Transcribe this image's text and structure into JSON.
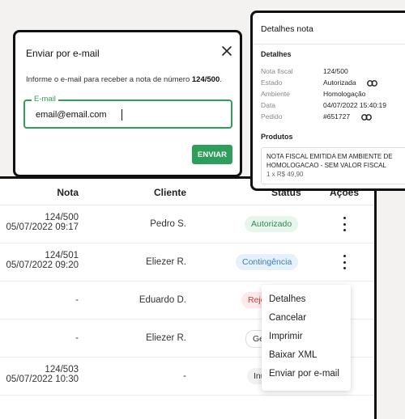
{
  "table": {
    "headers": {
      "nota": "Nota",
      "cliente": "Cliente",
      "status": "Status",
      "acoes": "Ações"
    },
    "rows": [
      {
        "nota_number": "124/500",
        "nota_date": "05/07/2022 09:17",
        "cliente": "Pedro S.",
        "status": "Autorizado"
      },
      {
        "nota_number": "124/501",
        "nota_date": "05/07/2022 09:20",
        "cliente": "Eliezer R.",
        "status": "Contingência"
      },
      {
        "nota_dash": "-",
        "cliente": "Eduardo D.",
        "status": "Rejeitado",
        "status_visible": "Reje"
      },
      {
        "nota_dash": "-",
        "cliente": "Eliezer R.",
        "status": "Gerada",
        "status_visible": "Ge"
      },
      {
        "nota_number": "124/503",
        "nota_date": "05/07/2022 10:30",
        "cliente": "-",
        "status": "Inutilizada",
        "status_visible": "Inu"
      }
    ]
  },
  "menu": {
    "items": [
      "Detalhes",
      "Cancelar",
      "Imprimir",
      "Baixar XML",
      "Enviar por e-mail"
    ]
  },
  "email_dialog": {
    "title": "Enviar por e-mail",
    "text_prefix": "Informe o e-mail para receber a nota de número ",
    "nota_number": "124/500",
    "text_suffix": ".",
    "field_label": "E-mail",
    "field_value": "email@email.com",
    "send_label": "ENVIAR"
  },
  "details": {
    "title": "Detalhes nota",
    "section_detalhes": "Detalhes",
    "fields": [
      {
        "label": "Nota fiscal",
        "value": "124/500"
      },
      {
        "label": "Estado",
        "value": "Autorizada"
      },
      {
        "label": "Ambiente",
        "value": "Homologação"
      },
      {
        "label": "Data",
        "value": "04/07/2022 15:40:19"
      },
      {
        "label": "Pedido",
        "value": "#651727"
      }
    ],
    "section_produtos": "Produtos",
    "product": {
      "name": "NOTA FISCAL EMITIDA EM AMBIENTE DE HOMOLOGACAO - SEM VALOR FISCAL",
      "qty_price": "1 x R$ 49,90"
    }
  },
  "colors": {
    "primary_green": "#2e9e5b",
    "status_authorized": "#2e8b4e",
    "status_contingency": "#3a7cc4",
    "status_rejected": "#d43a3a"
  }
}
